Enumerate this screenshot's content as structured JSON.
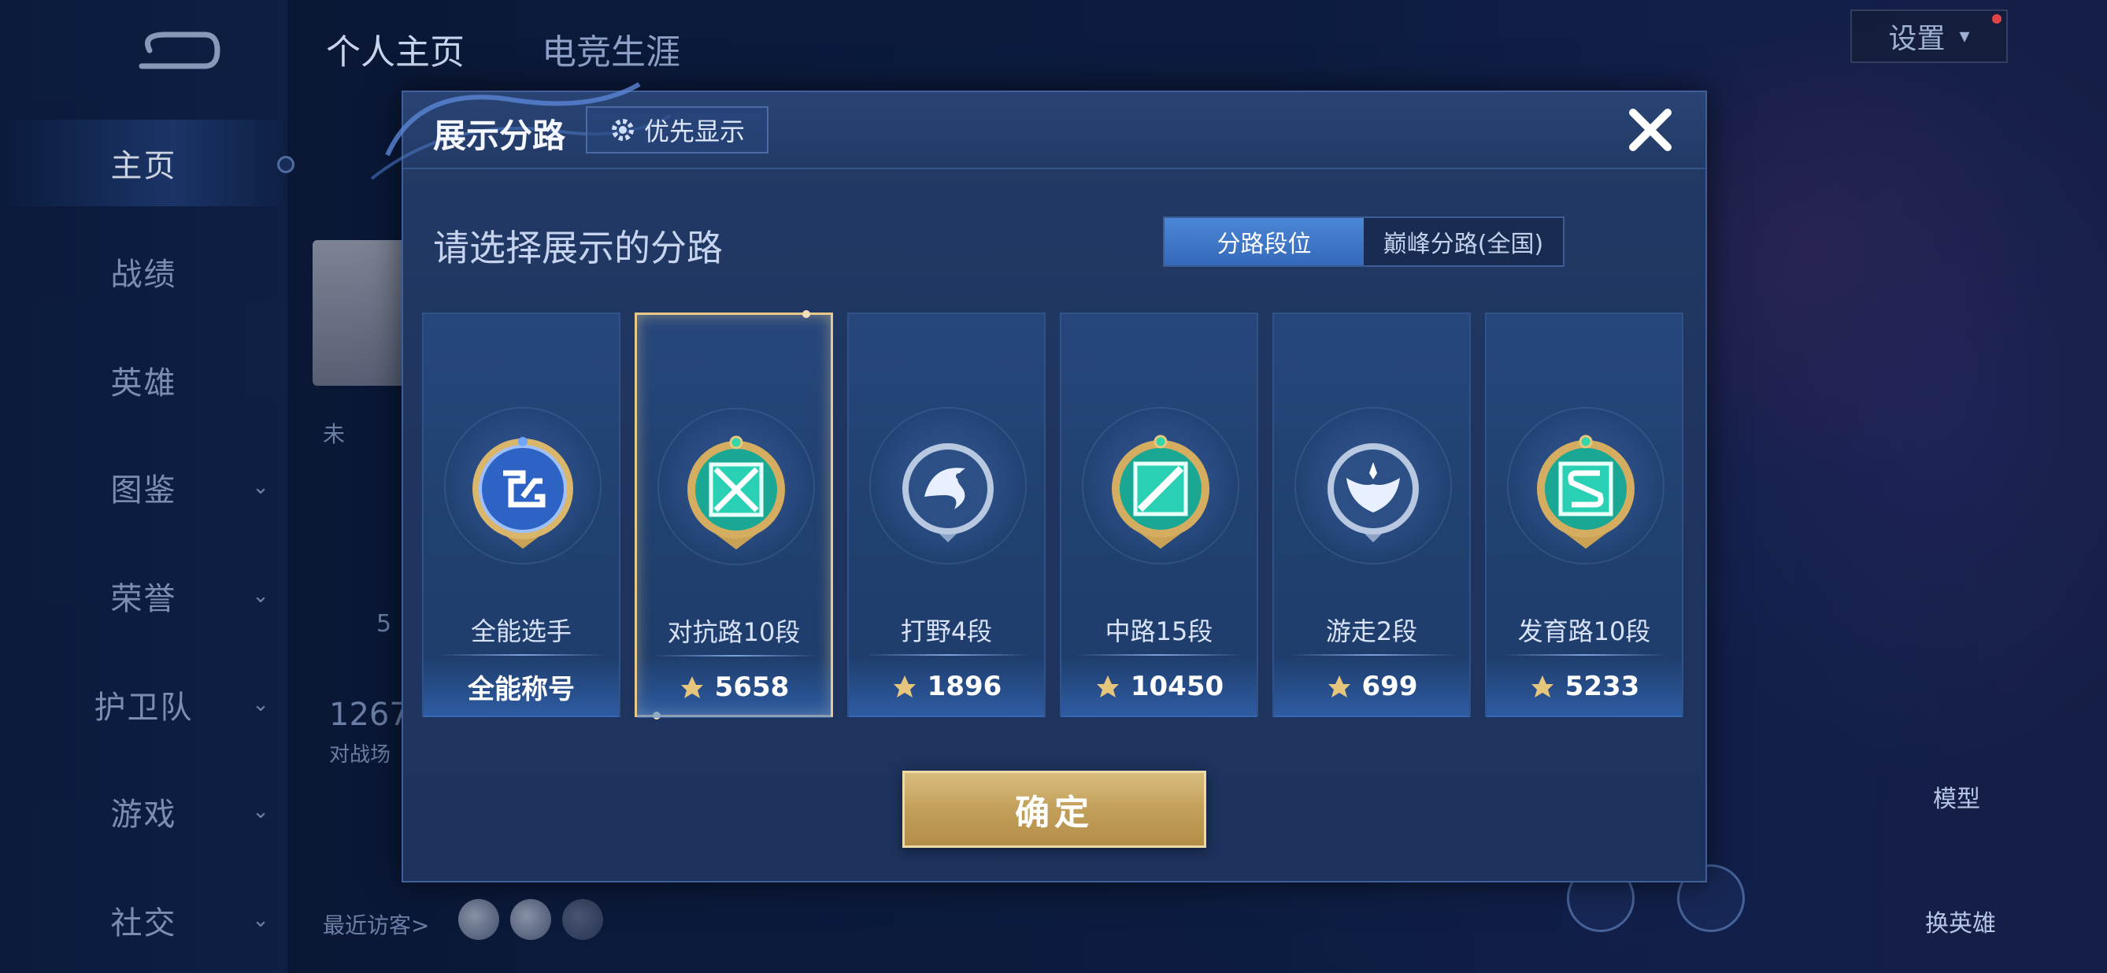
{
  "header": {
    "tabs": [
      {
        "label": "个人主页"
      },
      {
        "label": "电竞生涯"
      }
    ],
    "settings_label": "设置"
  },
  "sidebar": {
    "items": [
      {
        "label": "主页",
        "active": true
      },
      {
        "label": "战绩"
      },
      {
        "label": "英雄"
      },
      {
        "label": "图鉴"
      },
      {
        "label": "荣誉"
      },
      {
        "label": "护卫队"
      },
      {
        "label": "游戏"
      },
      {
        "label": "社交"
      }
    ]
  },
  "profile": {
    "status_fragment": "未",
    "number_fragment": "5",
    "match_count": "1267",
    "match_label": "对战场",
    "recent_visitors": "最近访客>"
  },
  "right": {
    "model_label": "模型",
    "change_hero_label": "换英雄"
  },
  "modal": {
    "title": "展示分路",
    "priority_label": "优先显示",
    "subtitle": "请选择展示的分路",
    "toggle": [
      {
        "label": "分路段位",
        "active": true
      },
      {
        "label": "巅峰分路(全国)",
        "active": false
      }
    ],
    "cards": [
      {
        "label": "全能选手",
        "foot": "全能称号",
        "selected": false,
        "emblem": "allround-emblem-icon"
      },
      {
        "label": "对抗路10段",
        "foot": "5658",
        "selected": true,
        "emblem": "clash-lane-emblem-icon"
      },
      {
        "label": "打野4段",
        "foot": "1896",
        "selected": false,
        "emblem": "jungle-emblem-icon"
      },
      {
        "label": "中路15段",
        "foot": "10450",
        "selected": false,
        "emblem": "mid-lane-emblem-icon"
      },
      {
        "label": "游走2段",
        "foot": "699",
        "selected": false,
        "emblem": "roam-emblem-icon"
      },
      {
        "label": "发育路10段",
        "foot": "5233",
        "selected": false,
        "emblem": "farm-lane-emblem-icon"
      }
    ],
    "confirm_label": "确定"
  },
  "colors": {
    "accent_blue": "#3f74c4",
    "gold": "#d4b06a",
    "panel": "#213862"
  }
}
